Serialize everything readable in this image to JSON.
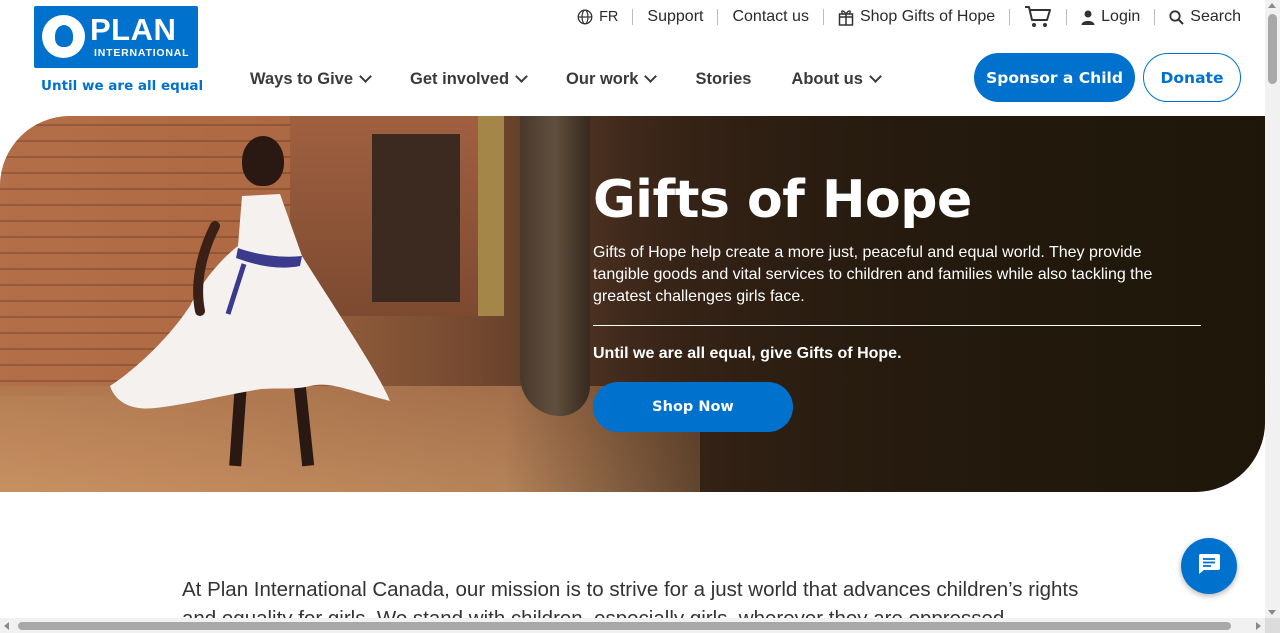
{
  "brand": {
    "logo_word": "PLAN",
    "logo_subword": "INTERNATIONAL",
    "tagline": "Until we are all equal",
    "primary_color": "#0072ce"
  },
  "utility_nav": {
    "language": {
      "label": "FR",
      "icon": "globe-icon"
    },
    "support": "Support",
    "contact": "Contact us",
    "shop": {
      "label": "Shop Gifts of Hope",
      "icon": "gift-icon"
    },
    "cart": {
      "icon": "cart-icon"
    },
    "login": {
      "label": "Login",
      "icon": "user-icon"
    },
    "search": {
      "label": "Search",
      "icon": "search-icon"
    }
  },
  "main_nav": {
    "items": [
      {
        "label": "Ways to Give",
        "has_dropdown": true
      },
      {
        "label": "Get involved",
        "has_dropdown": true
      },
      {
        "label": "Our work",
        "has_dropdown": true
      },
      {
        "label": "Stories",
        "has_dropdown": false
      },
      {
        "label": "About us",
        "has_dropdown": true
      }
    ],
    "sponsor_label": "Sponsor a Child",
    "donate_label": "Donate"
  },
  "hero": {
    "title": "Gifts of Hope",
    "description": "Gifts of Hope help create a more just, peaceful and equal world. They provide tangible goods and vital services to children and families while also tackling the greatest challenges girls face.",
    "tagline": "Until we are all equal, give Gifts of Hope.",
    "cta_label": "Shop Now"
  },
  "body": {
    "mission_text": "At Plan International Canada, our mission is to strive for a just world that advances children’s rights and equality for girls. We stand with children, especially girls, wherever they are oppressed,"
  },
  "chat": {
    "icon": "chat-icon"
  }
}
